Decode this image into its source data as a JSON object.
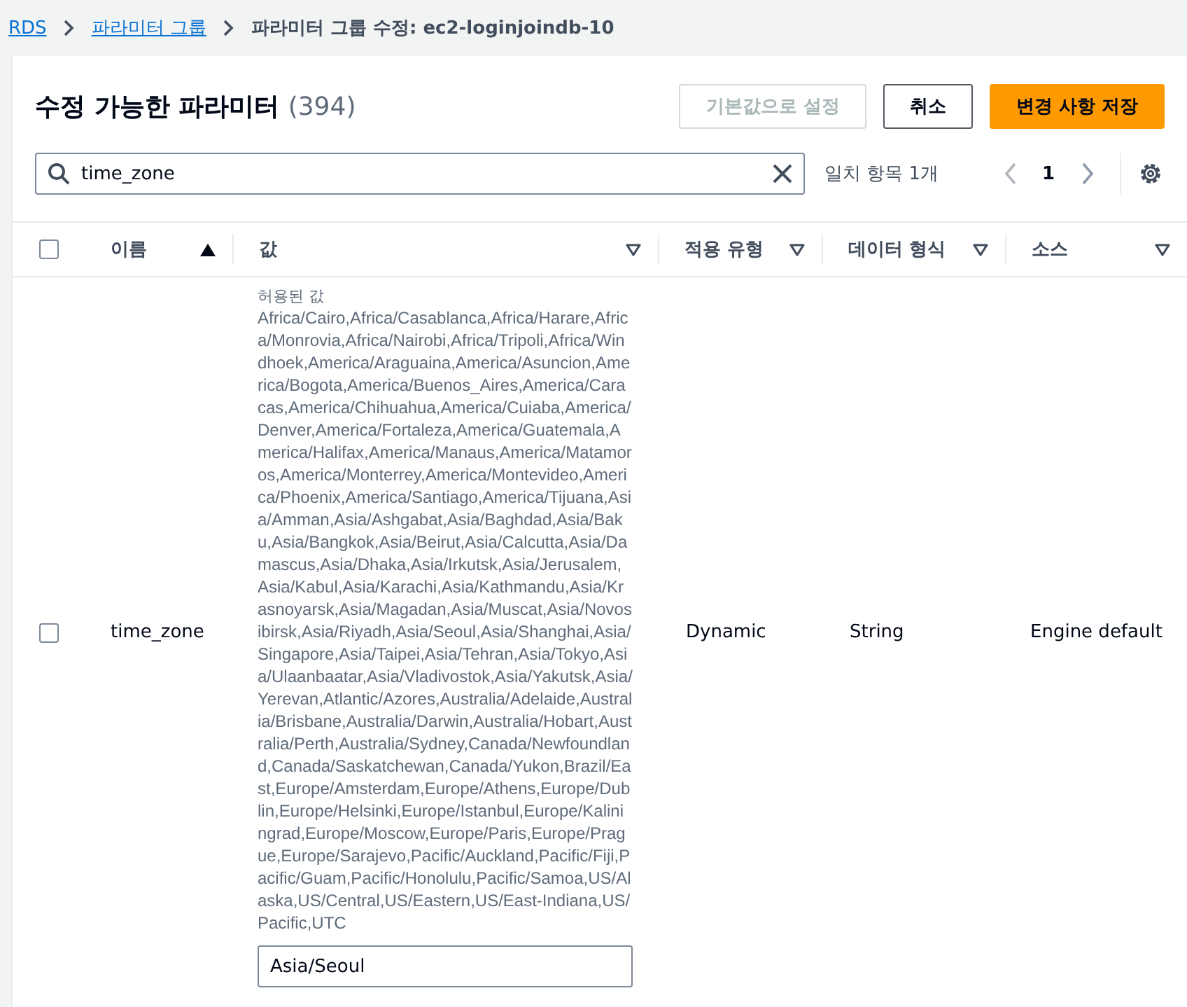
{
  "breadcrumb": [
    {
      "label": "RDS",
      "kind": "link"
    },
    {
      "label": "파라미터 그룹",
      "kind": "link"
    },
    {
      "label": "파라미터 그룹 수정: ec2-loginjoindb-10",
      "kind": "current"
    }
  ],
  "header": {
    "title": "수정 가능한 파라미터",
    "count": "(394)"
  },
  "buttons": [
    {
      "label": "기본값으로 설정",
      "kind": "normal",
      "disabled": true
    },
    {
      "label": "취소",
      "kind": "normal",
      "disabled": false
    },
    {
      "label": "변경 사항 저장",
      "kind": "primary",
      "disabled": false
    }
  ],
  "search": {
    "value": "time_zone"
  },
  "match_count": "일치 항목 1개",
  "pagination": {
    "page": "1",
    "prev_disabled": true,
    "next_disabled": false
  },
  "table": {
    "all_selected": false,
    "columns": [
      {
        "label": "이름",
        "kind": "sorted"
      },
      {
        "label": "값",
        "kind": "filter"
      },
      {
        "label": "적용 유형",
        "kind": "filter"
      },
      {
        "label": "데이터 형식",
        "kind": "filter"
      },
      {
        "label": "소스",
        "kind": "filter"
      }
    ],
    "rows": [
      {
        "selected": false,
        "name": "time_zone",
        "allowed_label": "허용된 값",
        "allowed_values": "Africa/Cairo,Africa/Casablanca,Africa/Harare,Africa/Monrovia,Africa/Nairobi,Africa/Tripoli,Africa/Windhoek,America/Araguaina,America/Asuncion,America/Bogota,America/Buenos_Aires,America/Caracas,America/Chihuahua,America/Cuiaba,America/Denver,America/Fortaleza,America/Guatemala,America/Halifax,America/Manaus,America/Matamoros,America/Monterrey,America/Montevideo,America/Phoenix,America/Santiago,America/Tijuana,Asia/Amman,Asia/Ashgabat,Asia/Baghdad,Asia/Baku,Asia/Bangkok,Asia/Beirut,Asia/Calcutta,Asia/Damascus,Asia/Dhaka,Asia/Irkutsk,Asia/Jerusalem,Asia/Kabul,Asia/Karachi,Asia/Kathmandu,Asia/Krasnoyarsk,Asia/Magadan,Asia/Muscat,Asia/Novosibirsk,Asia/Riyadh,Asia/Seoul,Asia/Shanghai,Asia/Singapore,Asia/Taipei,Asia/Tehran,Asia/Tokyo,Asia/Ulaanbaatar,Asia/Vladivostok,Asia/Yakutsk,Asia/Yerevan,Atlantic/Azores,Australia/Adelaide,Australia/Brisbane,Australia/Darwin,Australia/Hobart,Australia/Perth,Australia/Sydney,Canada/Newfoundland,Canada/Saskatchewan,Canada/Yukon,Brazil/East,Europe/Amsterdam,Europe/Athens,Europe/Dublin,Europe/Helsinki,Europe/Istanbul,Europe/Kaliningrad,Europe/Moscow,Europe/Paris,Europe/Prague,Europe/Sarajevo,Pacific/Auckland,Pacific/Fiji,Pacific/Guam,Pacific/Honolulu,Pacific/Samoa,US/Alaska,US/Central,US/Eastern,US/East-Indiana,US/Pacific,UTC",
        "value": "Asia/Seoul",
        "apply_type": "Dynamic",
        "data_type": "String",
        "source": "Engine default"
      }
    ]
  }
}
